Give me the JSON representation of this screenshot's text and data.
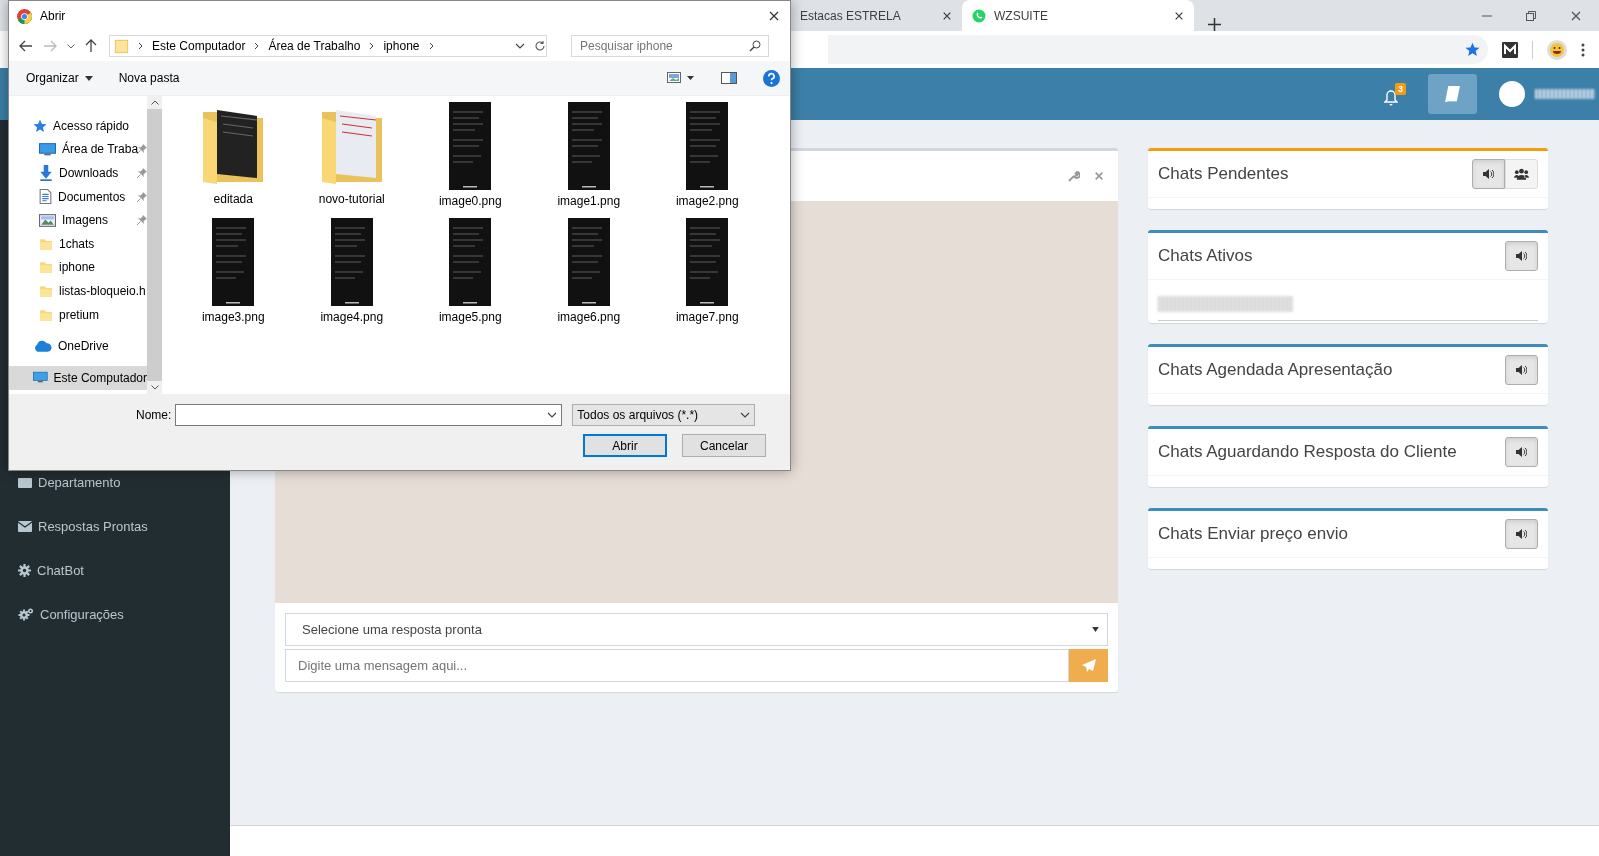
{
  "browser": {
    "tabs": [
      {
        "title": "Estacas ESTRELA",
        "selected": false
      },
      {
        "title": "WZSUITE",
        "selected": true
      }
    ]
  },
  "app": {
    "notification_count": "3",
    "sidebar": {
      "items": [
        {
          "label": "Departamento",
          "kind": "department"
        },
        {
          "label": "Respostas Prontas",
          "kind": "replies"
        },
        {
          "label": "ChatBot",
          "kind": "chatbot"
        },
        {
          "label": "Configurações",
          "kind": "settings"
        }
      ]
    },
    "chat": {
      "reply_select": {
        "value": "Selecione uma resposta pronta"
      },
      "message": {
        "placeholder": "Digite uma mensagem aqui..."
      }
    },
    "queues": [
      {
        "title": "Chats Pendentes",
        "color": "#f39c12",
        "kind": "with-group",
        "has_entry": false
      },
      {
        "title": "Chats Ativos",
        "color": "#3c8dbc",
        "kind": "plain",
        "has_entry": true
      },
      {
        "title": "Chats Agendada Apresentação",
        "color": "#3c8dbc",
        "kind": "plain",
        "has_entry": false
      },
      {
        "title": "Chats Aguardando Resposta do Cliente",
        "color": "#3c8dbc",
        "kind": "plain",
        "has_entry": false
      },
      {
        "title": "Chats Enviar preço envio",
        "color": "#3c8dbc",
        "kind": "plain",
        "has_entry": false
      }
    ]
  },
  "dialog": {
    "title": "Abrir",
    "breadcrumb": [
      "Este Computador",
      "Área de Trabalho",
      "iphone"
    ],
    "search": {
      "placeholder": "Pesquisar iphone"
    },
    "toolbar": [
      "Organizar",
      "Nova pasta"
    ],
    "nav": [
      {
        "label": "Acesso rápido",
        "kind": "star",
        "pinned": false,
        "selected": false
      },
      {
        "label": "Área de Traba",
        "kind": "desktop",
        "pinned": true,
        "selected": false
      },
      {
        "label": "Downloads",
        "kind": "download",
        "pinned": true,
        "selected": false
      },
      {
        "label": "Documentos",
        "kind": "document",
        "pinned": true,
        "selected": false
      },
      {
        "label": "Imagens",
        "kind": "pictures",
        "pinned": true,
        "selected": false
      },
      {
        "label": "1chats",
        "kind": "folder",
        "pinned": false,
        "selected": false
      },
      {
        "label": "iphone",
        "kind": "folder",
        "pinned": false,
        "selected": false
      },
      {
        "label": "listas-bloqueio.h",
        "kind": "folder",
        "pinned": false,
        "selected": false
      },
      {
        "label": "pretium",
        "kind": "folder",
        "pinned": false,
        "selected": false
      },
      {
        "label": "OneDrive",
        "kind": "cloud",
        "pinned": false,
        "selected": false
      },
      {
        "label": "Este Computador",
        "kind": "computer",
        "pinned": false,
        "selected": true
      }
    ],
    "files": [
      {
        "name": "editada",
        "kind": "folder"
      },
      {
        "name": "novo-tutorial",
        "kind": "folder"
      },
      {
        "name": "image0.png",
        "kind": "image"
      },
      {
        "name": "image1.png",
        "kind": "image"
      },
      {
        "name": "image2.png",
        "kind": "image"
      },
      {
        "name": "image3.png",
        "kind": "image"
      },
      {
        "name": "image4.png",
        "kind": "image"
      },
      {
        "name": "image5.png",
        "kind": "image"
      },
      {
        "name": "image6.png",
        "kind": "image"
      },
      {
        "name": "image7.png",
        "kind": "image"
      }
    ],
    "name_label": "Nome:",
    "filter": "Todos os arquivos (*.*)",
    "buttons": [
      "Abrir",
      "Cancelar"
    ]
  }
}
